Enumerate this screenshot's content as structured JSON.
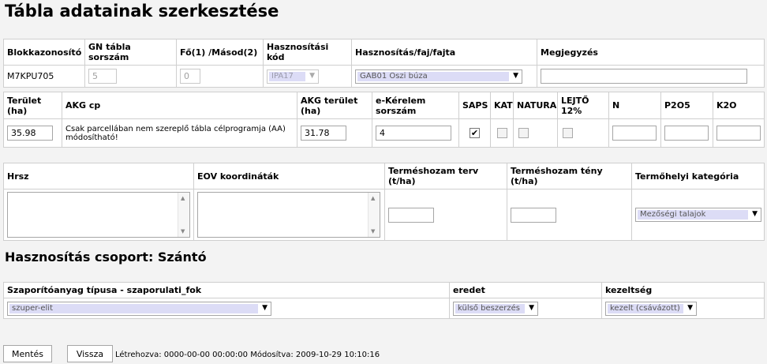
{
  "page": {
    "title": "Tábla adatainak szerkesztése"
  },
  "table1": {
    "headers": {
      "blokk": "Blokkazonosító",
      "gn": "GN tábla sorszám",
      "fo": "Fő(1) /Másod(2)",
      "hkod": "Hasznosítási kód",
      "hfaj": "Hasznosítás/faj/fajta",
      "megj": "Megjegyzés"
    },
    "values": {
      "blokk": "M7KPU705",
      "gn": "5",
      "fo": "0",
      "hkod": "IPA17",
      "hfaj": "GAB01 Őszi búza",
      "megj": ""
    }
  },
  "table2": {
    "headers": {
      "terulet": "Terület (ha)",
      "akgcp": "AKG cp",
      "akgter": "AKG terület (ha)",
      "ekerelem": "e-Kérelem sorszám",
      "saps": "SAPS",
      "kat": "KAT",
      "natura": "NATURA",
      "lejto": "LEJTŐ 12%",
      "n": "N",
      "p2o5": "P2O5",
      "k2o": "K2O"
    },
    "values": {
      "terulet": "35.98",
      "akgcp": "Csak parcellában nem szereplő tábla célprogramja (AA) módosítható!",
      "akgter": "31.78",
      "ekerelem": "4",
      "saps_checked": true,
      "kat_checked": false,
      "natura_checked": false,
      "lejto_checked": false,
      "n": "",
      "p2o5": "",
      "k2o": ""
    }
  },
  "table3": {
    "headers": {
      "hrsz": "Hrsz",
      "eov": "EOV koordináták",
      "tterv": "Terméshozam terv (t/ha)",
      "ttény": "Terméshozam tény (t/ha)",
      "termohely": "Termőhelyi kategória"
    },
    "values": {
      "hrsz": "",
      "eov": "",
      "tterv": "",
      "ttény": "",
      "termohely": "Mezőségi talajok"
    }
  },
  "section": {
    "title": "Hasznosítás csoport: Szántó"
  },
  "table4": {
    "headers": {
      "szap": "Szaporítóanyag típusa - szaporulati_fok",
      "eredet": "eredet",
      "kezeltseg": "kezeltség"
    },
    "values": {
      "szap": "szuper-elit",
      "eredet": "külső beszerzés",
      "kezeltseg": "kezelt (csávázott)"
    }
  },
  "footer": {
    "save": "Mentés",
    "back": "Vissza",
    "note": "Létrehozva: 0000-00-00 00:00:00 Módosítva: 2009-10-29 10:10:16"
  }
}
